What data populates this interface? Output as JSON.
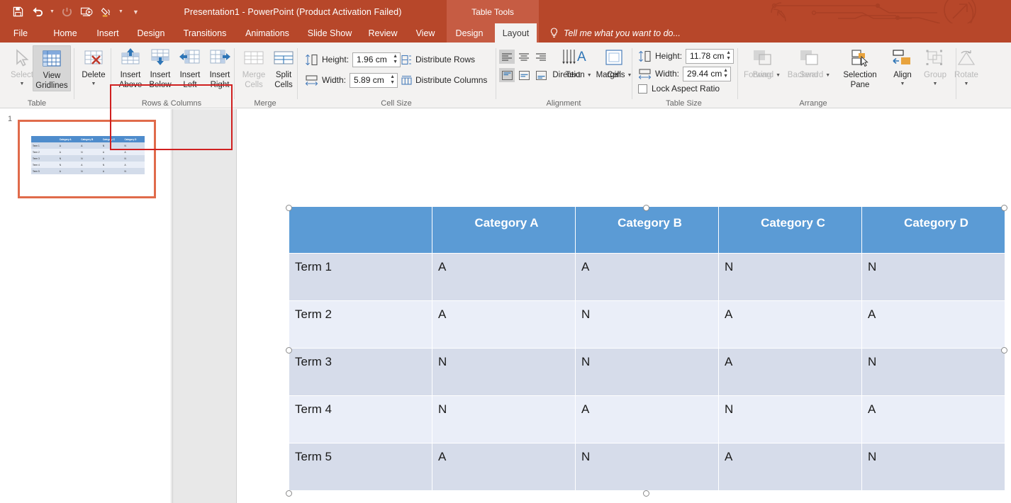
{
  "titlebar": {
    "document_title": "Presentation1 - PowerPoint (Product Activation Failed)",
    "context_tool_label": "Table Tools",
    "quick_access": [
      {
        "name": "save-icon",
        "label": "Save"
      },
      {
        "name": "undo-icon",
        "label": "Undo"
      },
      {
        "name": "redo-icon",
        "label": "Redo"
      },
      {
        "name": "start-from-beginning-icon",
        "label": "Start From Beginning"
      },
      {
        "name": "format-painter-icon",
        "label": "Format"
      },
      {
        "name": "customize-quick-access-toolbar-icon",
        "label": "Customize Quick Access Toolbar"
      }
    ]
  },
  "tabs": [
    {
      "label": "File",
      "active": false
    },
    {
      "label": "Home",
      "active": false
    },
    {
      "label": "Insert",
      "active": false
    },
    {
      "label": "Design",
      "active": false
    },
    {
      "label": "Transitions",
      "active": false
    },
    {
      "label": "Animations",
      "active": false
    },
    {
      "label": "Slide Show",
      "active": false
    },
    {
      "label": "Review",
      "active": false
    },
    {
      "label": "View",
      "active": false
    },
    {
      "label": "Design",
      "active": false
    },
    {
      "label": "Layout",
      "active": true
    }
  ],
  "tell_me": {
    "placeholder": "Tell me what you want to do..."
  },
  "ribbon": {
    "groups": [
      {
        "name": "table",
        "label": "Table",
        "items": [
          {
            "label_line1": "Select",
            "label_line2": "",
            "icon": "cursor-arrow-icon",
            "state": "disabled",
            "has_caret": true
          },
          {
            "label_line1": "View",
            "label_line2": "Gridlines",
            "icon": "grid-table-icon",
            "state": "toggled",
            "has_caret": false
          }
        ]
      },
      {
        "name": "delete",
        "label": "",
        "items": [
          {
            "label_line1": "Delete",
            "label_line2": "",
            "icon": "table-delete-icon",
            "state": "normal",
            "has_caret": true
          }
        ]
      },
      {
        "name": "rows-and-columns",
        "label": "Rows & Columns",
        "highlighted": true,
        "items": [
          {
            "label_line1": "Insert",
            "label_line2": "Above",
            "icon": "insert-row-above-icon",
            "state": "normal",
            "has_caret": false
          },
          {
            "label_line1": "Insert",
            "label_line2": "Below",
            "icon": "insert-row-below-icon",
            "state": "normal",
            "has_caret": false
          },
          {
            "label_line1": "Insert",
            "label_line2": "Left",
            "icon": "insert-column-left-icon",
            "state": "normal",
            "has_caret": false
          },
          {
            "label_line1": "Insert",
            "label_line2": "Right",
            "icon": "insert-column-right-icon",
            "state": "normal",
            "has_caret": false
          }
        ]
      },
      {
        "name": "merge",
        "label": "Merge",
        "items": [
          {
            "label_line1": "Merge",
            "label_line2": "Cells",
            "icon": "merge-cells-icon",
            "state": "disabled",
            "has_caret": false
          },
          {
            "label_line1": "Split",
            "label_line2": "Cells",
            "icon": "split-cells-icon",
            "state": "normal",
            "has_caret": false
          }
        ]
      },
      {
        "name": "cell-size",
        "label": "Cell Size",
        "height_label": "Height:",
        "height_value": "1.96 cm",
        "width_label": "Width:",
        "width_value": "5.89 cm",
        "distribute_rows": "Distribute Rows",
        "distribute_columns": "Distribute Columns"
      },
      {
        "name": "alignment",
        "label": "Alignment",
        "items": [
          {
            "label_line1": "Text",
            "label_line2": "Direction",
            "icon": "text-direction-icon",
            "state": "normal",
            "has_caret": true
          },
          {
            "label_line1": "Cell",
            "label_line2": "Margins",
            "icon": "cell-margins-icon",
            "state": "normal",
            "has_caret": true
          }
        ],
        "align_buttons": [
          {
            "name": "align-left-icon",
            "active": true
          },
          {
            "name": "align-center-icon",
            "active": false
          },
          {
            "name": "align-right-icon",
            "active": false
          },
          {
            "name": "align-top-icon",
            "active": true
          },
          {
            "name": "align-middle-icon",
            "active": false
          },
          {
            "name": "align-bottom-icon",
            "active": false
          }
        ]
      },
      {
        "name": "table-size",
        "label": "Table Size",
        "height_label": "Height:",
        "height_value": "11.78 cm",
        "width_label": "Width:",
        "width_value": "29.44 cm",
        "lock_aspect_label": "Lock Aspect Ratio",
        "lock_aspect_checked": false
      },
      {
        "name": "arrange",
        "label": "Arrange",
        "items": [
          {
            "label_line1": "Bring",
            "label_line2": "Forward",
            "icon": "bring-forward-icon",
            "state": "disabled",
            "has_caret": true
          },
          {
            "label_line1": "Send",
            "label_line2": "Backward",
            "icon": "send-backward-icon",
            "state": "disabled",
            "has_caret": true
          },
          {
            "label_line1": "Selection",
            "label_line2": "Pane",
            "icon": "selection-pane-icon",
            "state": "normal",
            "has_caret": false
          },
          {
            "label_line1": "Align",
            "label_line2": "",
            "icon": "align-objects-icon",
            "state": "normal",
            "has_caret": true
          },
          {
            "label_line1": "Group",
            "label_line2": "",
            "icon": "group-objects-icon",
            "state": "disabled",
            "has_caret": true
          },
          {
            "label_line1": "Rotate",
            "label_line2": "",
            "icon": "rotate-objects-icon",
            "state": "disabled",
            "has_caret": true
          }
        ]
      }
    ]
  },
  "slide_panel": {
    "slide_number": "1"
  },
  "table": {
    "headers": [
      "",
      "Category A",
      "Category B",
      "Category C",
      "Category D"
    ],
    "rows": [
      [
        "Term 1",
        "A",
        "A",
        "N",
        "N"
      ],
      [
        "Term 2",
        "A",
        "N",
        "A",
        "A"
      ],
      [
        "Term 3",
        "N",
        "N",
        "A",
        "N"
      ],
      [
        "Term 4",
        "N",
        "A",
        "N",
        "A"
      ],
      [
        "Term 5",
        "A",
        "N",
        "A",
        "N"
      ]
    ]
  },
  "colors": {
    "ribbon_accent": "#b7472a",
    "table_header": "#5b9bd5",
    "row_odd": "#d6dcea",
    "row_even": "#eaeef8",
    "highlight_box": "#d02020",
    "thumb_border": "#e06b4b"
  }
}
